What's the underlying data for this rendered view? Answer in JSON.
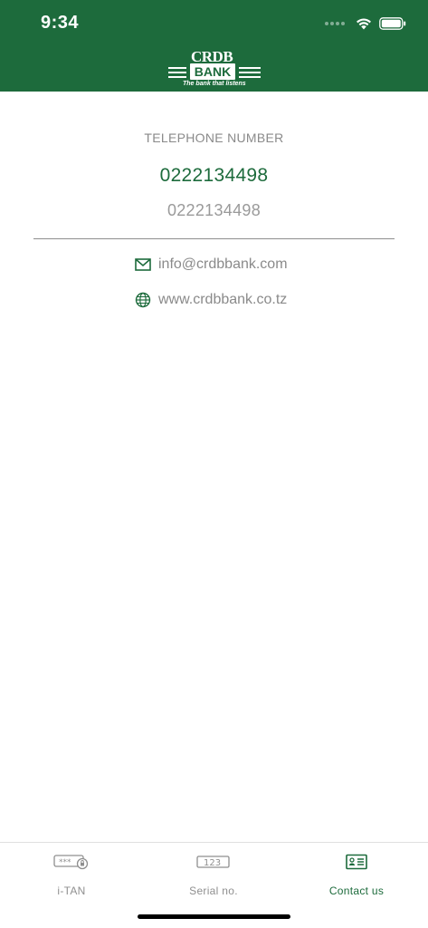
{
  "status_bar": {
    "time": "9:34"
  },
  "header": {
    "logo_word": "CRDB",
    "logo_bank": "BANK",
    "logo_tagline": "The bank that listens",
    "brand_color": "#1d6b3c"
  },
  "telephone": {
    "title": "TELEPHONE NUMBER",
    "primary": "0222134498",
    "secondary": "0222134498"
  },
  "contacts": {
    "email": "info@crdbbank.com",
    "email_icon": "mail-icon",
    "website": "www.crdbbank.co.tz",
    "website_icon": "globe-icon"
  },
  "tabbar": {
    "tabs": [
      {
        "label": "i-TAN",
        "icon": "password-lock-icon",
        "active": false
      },
      {
        "label": "Serial no.",
        "icon": "number-field-icon",
        "active": false
      },
      {
        "label": "Contact us",
        "icon": "contact-card-icon",
        "active": true
      }
    ]
  }
}
